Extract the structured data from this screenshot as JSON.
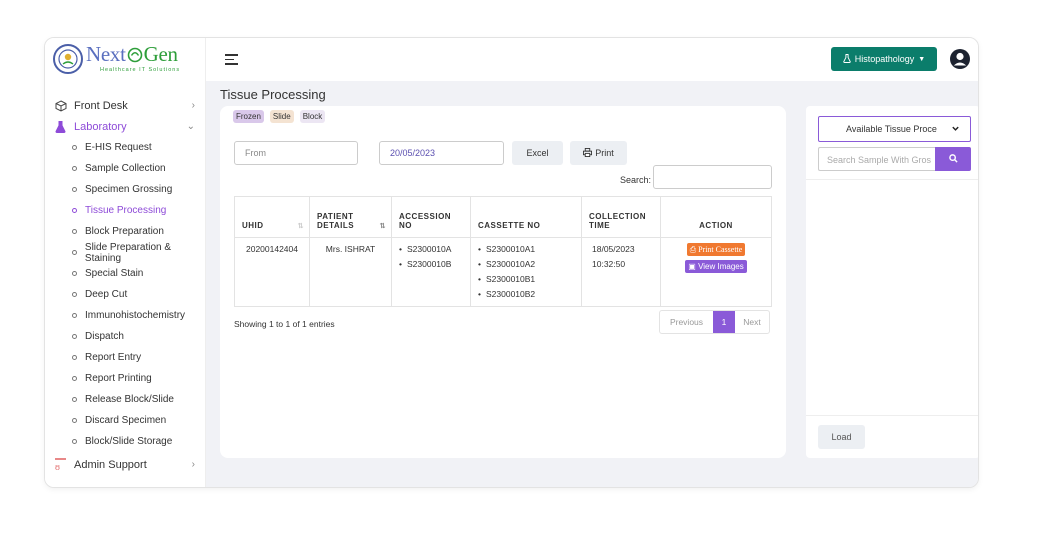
{
  "brand": {
    "name_part1": "Next",
    "name_part2": "Gen",
    "tagline": "Healthcare IT Solutions"
  },
  "sidebar": {
    "front_desk": "Front Desk",
    "laboratory": "Laboratory",
    "lab_items": [
      {
        "label": "E-HIS Request"
      },
      {
        "label": "Sample Collection"
      },
      {
        "label": "Specimen Grossing"
      },
      {
        "label": "Tissue Processing",
        "active": true
      },
      {
        "label": "Block Preparation"
      },
      {
        "label": "Slide Preparation & Staining"
      },
      {
        "label": "Special Stain"
      },
      {
        "label": "Deep Cut"
      },
      {
        "label": "Immunohistochemistry"
      },
      {
        "label": "Dispatch"
      },
      {
        "label": "Report Entry"
      },
      {
        "label": "Report Printing"
      },
      {
        "label": "Release Block/Slide"
      },
      {
        "label": "Discard Specimen"
      },
      {
        "label": "Block/Slide Storage"
      }
    ],
    "admin_support": "Admin Support"
  },
  "header": {
    "department": "Histopathology"
  },
  "page": {
    "title": "Tissue Processing",
    "tags": [
      "Frozen",
      "Slide",
      "Block"
    ],
    "from_placeholder": "From",
    "to_date": "20/05/2023",
    "excel": "Excel",
    "print": "Print",
    "search_label": "Search:"
  },
  "table": {
    "columns": [
      {
        "line1": "UHID",
        "line2": ""
      },
      {
        "line1": "PATIENT",
        "line2": "DETAILS"
      },
      {
        "line1": "ACCESSION",
        "line2": "NO"
      },
      {
        "line1": "CASSETTE NO",
        "line2": ""
      },
      {
        "line1": "COLLECTION",
        "line2": "TIME"
      },
      {
        "line1": "ACTION",
        "line2": ""
      }
    ],
    "rows": [
      {
        "uhid": "20200142404",
        "patient": "Mrs. ISHRAT",
        "accession": [
          "S2300010A",
          "S2300010B"
        ],
        "cassettes": [
          "S2300010A1",
          "S2300010A2",
          "S2300010B1",
          "S2300010B2"
        ],
        "collection_date": "18/05/2023",
        "collection_time": "10:32:50",
        "print_cassette": "Print Cassette",
        "view_images": "View Images"
      }
    ]
  },
  "footer": {
    "showing": "Showing 1 to 1 of 1 entries",
    "previous": "Previous",
    "page": "1",
    "next": "Next"
  },
  "right_panel": {
    "select_value": "Available Tissue Proce",
    "search_placeholder": "Search Sample With Gros",
    "load": "Load"
  },
  "colors": {
    "accent": "#8a5ad8",
    "teal": "#0b7d6b",
    "orange": "#f07930"
  }
}
